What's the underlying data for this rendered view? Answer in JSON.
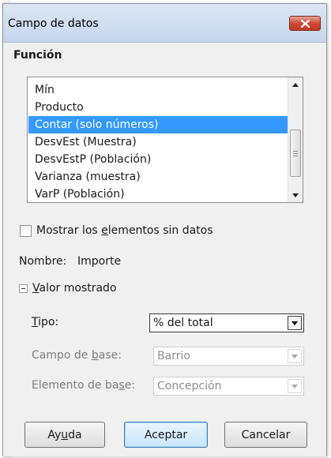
{
  "window": {
    "title": "Campo de datos"
  },
  "funcion": {
    "heading": "Función",
    "items": [
      {
        "label": "Mín",
        "selected": false
      },
      {
        "label": "Producto",
        "selected": false
      },
      {
        "label": "Contar (solo números)",
        "selected": true
      },
      {
        "label": "DesvEst (Muestra)",
        "selected": false
      },
      {
        "label": "DesvEstP (Población)",
        "selected": false
      },
      {
        "label": "Varianza (muestra)",
        "selected": false
      },
      {
        "label": "VarP (Población)",
        "selected": false
      }
    ]
  },
  "show_empty": {
    "pre": "Mostrar los ",
    "mnemonic": "e",
    "post": "lementos sin datos",
    "checked": false
  },
  "nombre": {
    "label": "Nombre:",
    "value": "Importe"
  },
  "valor_mostrado": {
    "mnemonic": "V",
    "post": "alor mostrado",
    "expanded": true
  },
  "tipo": {
    "mnemonic": "T",
    "post": "ipo:",
    "value": "% del total"
  },
  "campo_base": {
    "pre": "Campo de ",
    "mnemonic": "b",
    "post": "ase:",
    "value": "Barrio",
    "enabled": false
  },
  "elemento_base": {
    "pre": "Elemento de ba",
    "mnemonic": "s",
    "post": "e:",
    "value": "Concepción",
    "enabled": false
  },
  "buttons": {
    "help": {
      "pre": "Ay",
      "mnemonic": "u",
      "post": "da"
    },
    "ok": {
      "label": "Aceptar"
    },
    "cancel": {
      "label": "Cancelar"
    }
  },
  "colors": {
    "selection": "#3399ff",
    "titlebar": "#c5d6ec",
    "close": "#cf4b35"
  }
}
